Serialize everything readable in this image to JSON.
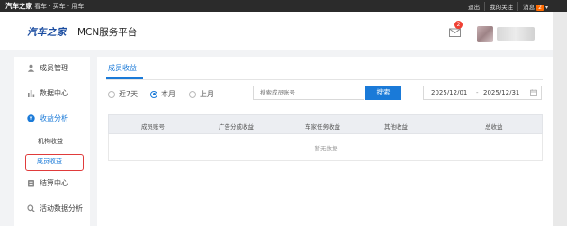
{
  "topbar": {
    "brand": "汽车之家",
    "brand_sub": "看车 · 买车 · 用车",
    "logout": "退出",
    "my_follow": "我的关注",
    "messages": "消息",
    "message_count": "2"
  },
  "header": {
    "logo": "汽车之家",
    "platform": "MCN服务平台",
    "mail_badge": "2"
  },
  "sidebar": {
    "items": [
      {
        "label": "成员管理",
        "icon": "user-icon"
      },
      {
        "label": "数据中心",
        "icon": "bar-chart-icon"
      },
      {
        "label": "收益分析",
        "icon": "yuan-circle-icon"
      },
      {
        "label": "结算中心",
        "icon": "settlement-icon"
      },
      {
        "label": "活动数据分析",
        "icon": "search-icon"
      }
    ],
    "sub_items": [
      {
        "label": "机构收益"
      },
      {
        "label": "成员收益"
      }
    ]
  },
  "main": {
    "tab": "成员收益",
    "radios": [
      {
        "label": "近7天",
        "checked": false
      },
      {
        "label": "本月",
        "checked": true
      },
      {
        "label": "上月",
        "checked": false
      }
    ],
    "search": {
      "placeholder": "搜索成员账号",
      "button": "搜索"
    },
    "date_range": {
      "start": "2025/12/01",
      "sep": "-",
      "end": "2025/12/31"
    },
    "table": {
      "columns": [
        "成员账号",
        "广告分成收益",
        "车家任务收益",
        "其他收益",
        "总收益"
      ],
      "empty_text": "暂无数据"
    }
  },
  "colors": {
    "accent": "#1a7ad8",
    "topbar": "#2b2b2b",
    "highlight": "#e03b3b"
  }
}
